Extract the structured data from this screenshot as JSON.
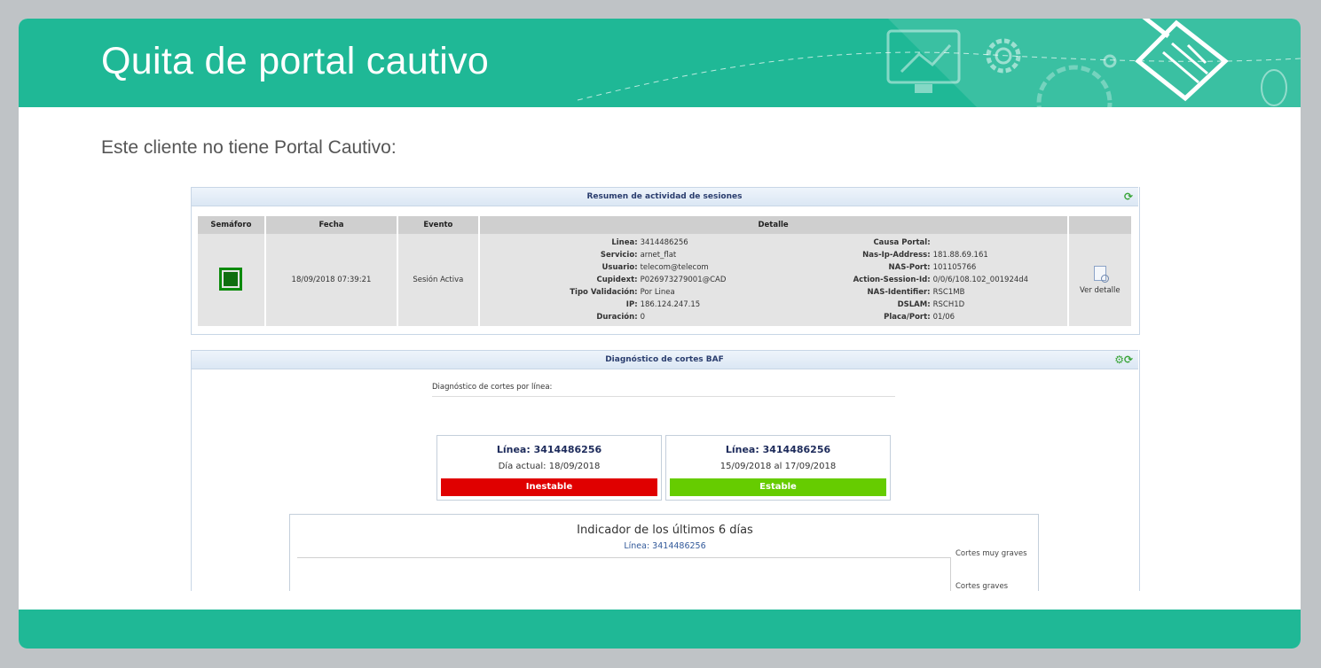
{
  "slide": {
    "title": "Quita de portal cautivo",
    "subtitle": "Este cliente no tiene Portal Cautivo:"
  },
  "colors": {
    "brand": "#1fb896",
    "unstable": "#e00000",
    "stable": "#66cc00",
    "semaforo": "#0f6e0f"
  },
  "sessions": {
    "header": "Resumen de actividad de sesiones",
    "columns": [
      "Semáforo",
      "Fecha",
      "Evento",
      "Detalle",
      ""
    ],
    "row": {
      "fecha": "18/09/2018 07:39:21",
      "evento": "Sesión Activa",
      "details_left": [
        {
          "k": "Linea:",
          "v": "3414486256"
        },
        {
          "k": "Servicio:",
          "v": "arnet_flat"
        },
        {
          "k": "Usuario:",
          "v": "telecom@telecom"
        },
        {
          "k": "Cupidext:",
          "v": "P026973279001@CAD"
        },
        {
          "k": "Tipo Validación:",
          "v": "Por Linea"
        },
        {
          "k": "IP:",
          "v": "186.124.247.15"
        },
        {
          "k": "Duración:",
          "v": "0"
        }
      ],
      "details_right": [
        {
          "k": "Causa Portal:",
          "v": ""
        },
        {
          "k": "Nas-Ip-Address:",
          "v": "181.88.69.161"
        },
        {
          "k": "NAS-Port:",
          "v": "101105766"
        },
        {
          "k": "Action-Session-Id:",
          "v": "0/0/6/108.102_001924d4"
        },
        {
          "k": "NAS-Identifier:",
          "v": "RSC1MB"
        },
        {
          "k": "DSLAM:",
          "v": "RSCH1D"
        },
        {
          "k": "Placa/Port:",
          "v": "01/06"
        }
      ],
      "action": "Ver detalle"
    }
  },
  "diagnostic": {
    "header": "Diagnóstico de cortes BAF",
    "label": "Diagnóstico de cortes por línea:",
    "cards": [
      {
        "line": "Línea: 3414486256",
        "date": "Día actual: 18/09/2018",
        "status": "Inestable"
      },
      {
        "line": "Línea: 3414486256",
        "date": "15/09/2018 al 17/09/2018",
        "status": "Estable"
      }
    ],
    "indicator": {
      "title": "Indicador de los últimos 6 días",
      "subtitle": "Línea: 3414486256",
      "legend": [
        "Cortes muy graves",
        "Cortes graves"
      ]
    }
  }
}
